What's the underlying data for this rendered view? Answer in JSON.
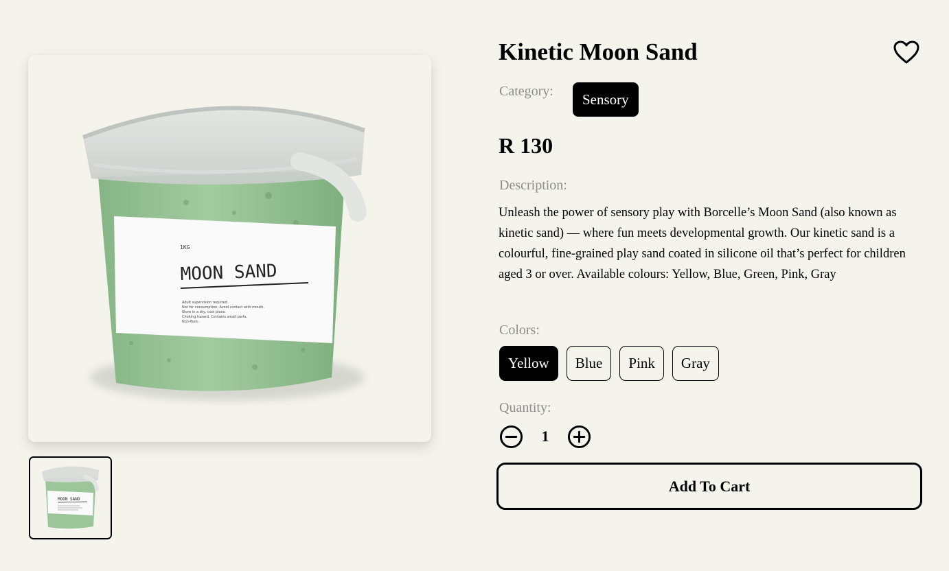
{
  "product": {
    "title": "Kinetic Moon Sand",
    "category_label": "Category:",
    "category": "Sensory",
    "price": "R 130",
    "description_label": "Description:",
    "description": "Unleash the power of sensory play with Borcelle’s Moon Sand (also known as kinetic sand) — where fun meets developmental growth. Our kinetic sand is a colourful, fine-grained play sand coated in silicone oil that’s perfect for children aged 3 or over. Available colours: Yellow, Blue, Green, Pink, Gray"
  },
  "image": {
    "label_weight": "1KG",
    "label_title": "MOON SAND",
    "label_bullets": [
      "Adult supervision required.",
      "Not for consumption. Avoid contact with mouth.",
      "Store in a dry, cool place.",
      "Choking hazard. Contains small parts.",
      "Non-Toxic."
    ],
    "thumb_label_title": "MOON SAND",
    "sand_color": "#9dc59a"
  },
  "colors": {
    "label": "Colors:",
    "options": [
      "Yellow",
      "Blue",
      "Pink",
      "Gray"
    ],
    "selected": "Yellow"
  },
  "quantity": {
    "label": "Quantity:",
    "value": "1"
  },
  "actions": {
    "add_to_cart": "Add To Cart",
    "wishlist_icon": "heart-outline-icon",
    "decrease_icon": "minus-circle-icon",
    "increase_icon": "plus-circle-icon"
  }
}
